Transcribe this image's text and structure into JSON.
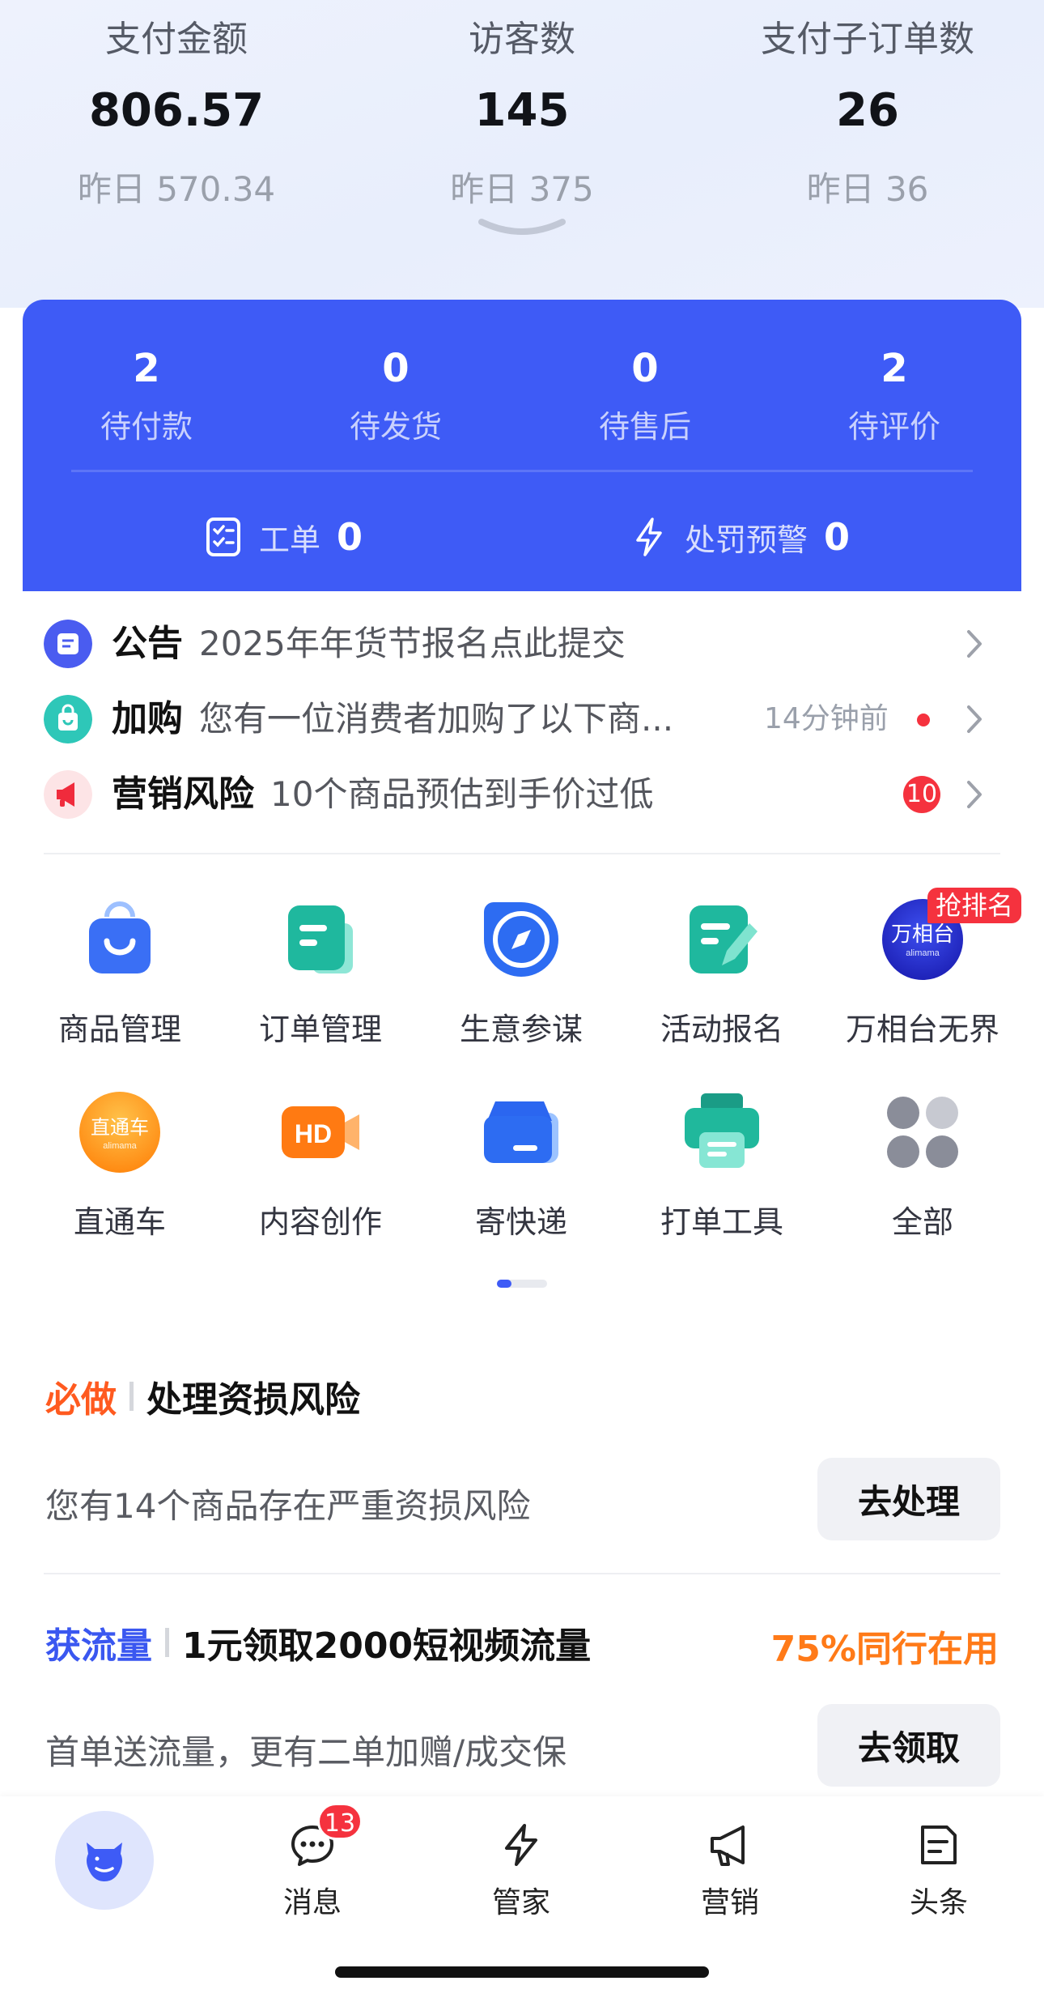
{
  "stats": [
    {
      "label": "支付金额",
      "value": "806.57",
      "yesterday": "昨日 570.34"
    },
    {
      "label": "访客数",
      "value": "145",
      "yesterday": "昨日 375"
    },
    {
      "label": "支付子订单数",
      "value": "26",
      "yesterday": "昨日 36"
    }
  ],
  "orders": [
    {
      "count": "2",
      "label": "待付款"
    },
    {
      "count": "0",
      "label": "待发货"
    },
    {
      "count": "0",
      "label": "待售后"
    },
    {
      "count": "2",
      "label": "待评价"
    }
  ],
  "tickets": [
    {
      "label": "工单",
      "count": "0",
      "icon": "ticket-icon"
    },
    {
      "label": "处罚预警",
      "count": "0",
      "icon": "lightning-icon"
    }
  ],
  "notices": [
    {
      "title": "公告",
      "body": "2025年年货节报名点此提交",
      "icon": "announcement-icon",
      "color": "#4a5cf0"
    },
    {
      "title": "加购",
      "body": "您有一位消费者加购了以下商...",
      "time": "14分钟前",
      "icon": "shopping-bag-icon",
      "color": "#2ec7b8"
    },
    {
      "title": "营销风险",
      "body": "10个商品预估到手价过低",
      "badge": "10",
      "icon": "megaphone-icon",
      "color": "#f02b3c"
    }
  ],
  "tools": [
    {
      "label": "商品管理",
      "icon": "product-bag-icon"
    },
    {
      "label": "订单管理",
      "icon": "order-doc-icon"
    },
    {
      "label": "生意参谋",
      "icon": "compass-icon"
    },
    {
      "label": "活动报名",
      "icon": "edit-doc-icon"
    },
    {
      "label": "万相台无界",
      "icon": "wanxiangtai-logo-icon",
      "logo_text": "万相台",
      "logo_sub": "alimama",
      "tag": "抢排名"
    },
    {
      "label": "直通车",
      "icon": "zhitongche-logo-icon",
      "logo_text": "直通车",
      "logo_sub": "alimama"
    },
    {
      "label": "内容创作",
      "icon": "hd-video-icon",
      "icon_text": "HD"
    },
    {
      "label": "寄快递",
      "icon": "express-box-icon"
    },
    {
      "label": "打单工具",
      "icon": "printer-icon"
    },
    {
      "label": "全部",
      "icon": "all-apps-icon"
    }
  ],
  "tasks": [
    {
      "tag": "必做",
      "tag_color": "#ff5a1f",
      "title": "处理资损风险",
      "desc": "您有14个商品存在严重资损风险",
      "button": "去处理"
    },
    {
      "tag": "获流量",
      "tag_color": "#3a57f0",
      "title": "1元领取2000短视频流量",
      "usage": "75%同行在用",
      "desc": "首单送流量，更有二单加赠/成交保",
      "button": "去领取"
    }
  ],
  "tabbar": {
    "items": [
      {
        "label": "消息",
        "icon": "message-icon",
        "badge": "13"
      },
      {
        "label": "管家",
        "icon": "lightning-icon"
      },
      {
        "label": "营销",
        "icon": "megaphone-icon"
      },
      {
        "label": "头条",
        "icon": "news-icon"
      }
    ],
    "home_icon": "cow-mascot-icon"
  },
  "colors": {
    "primary": "#3e5bf6",
    "danger": "#f5323e",
    "orange": "#ff7a18"
  }
}
